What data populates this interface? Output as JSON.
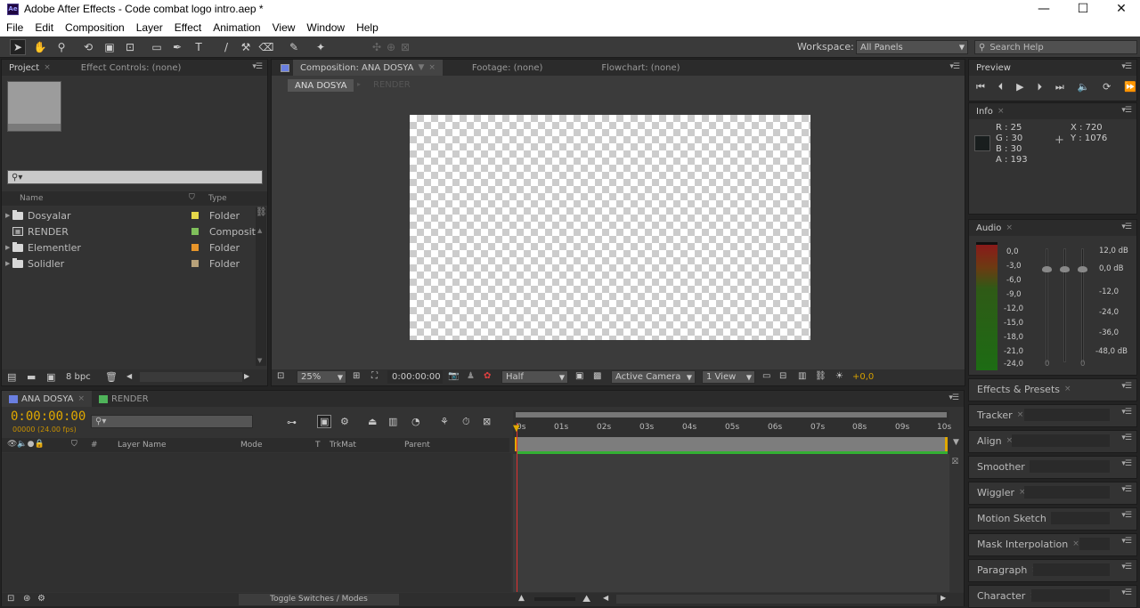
{
  "window": {
    "title": "Adobe After Effects - Code combat logo intro.aep *",
    "app_icon_text": "Ae",
    "minimize_glyph": "—",
    "maximize_glyph": "☐",
    "close_glyph": "✕"
  },
  "menu": [
    "File",
    "Edit",
    "Composition",
    "Layer",
    "Effect",
    "Animation",
    "View",
    "Window",
    "Help"
  ],
  "toolbar": {
    "workspace_label": "Workspace:",
    "workspace_value": "All Panels",
    "search_placeholder": "Search Help"
  },
  "project_panel": {
    "tabs": [
      {
        "label": "Project",
        "active": true
      },
      {
        "label": "Effect Controls: (none)",
        "active": false
      }
    ],
    "search_placeholder": "",
    "columns": {
      "name": "Name",
      "type": "Type"
    },
    "items": [
      {
        "name": "Dosyalar",
        "kind": "folder",
        "label_color": "#e6d84a",
        "type": "Folder"
      },
      {
        "name": "RENDER",
        "kind": "composition",
        "label_color": "#7fc05b",
        "type": "Compositi"
      },
      {
        "name": "Elementler",
        "kind": "folder",
        "label_color": "#e8952a",
        "type": "Folder"
      },
      {
        "name": "Solidler",
        "kind": "folder",
        "label_color": "#b8a27a",
        "type": "Folder"
      }
    ],
    "bpc": "8 bpc"
  },
  "composition_panel": {
    "tabs": [
      {
        "label": "Composition: ANA DOSYA",
        "active": true
      },
      {
        "label": "Footage: (none)",
        "active": false
      },
      {
        "label": "Flowchart: (none)",
        "active": false
      }
    ],
    "breadcrumb": [
      "ANA DOSYA",
      "RENDER"
    ],
    "zoom": "25%",
    "timecode": "0:00:00:00",
    "resolution": "Half",
    "camera": "Active Camera",
    "views": "1 View",
    "exposure": "+0,0"
  },
  "preview_panel": {
    "title": "Preview",
    "controls": [
      "first-frame",
      "previous-frame",
      "play",
      "next-frame",
      "last-frame",
      "audio",
      "loop",
      "ram-preview"
    ]
  },
  "info_panel": {
    "title": "Info",
    "r": "R : 25",
    "g": "G : 30",
    "b": "B : 30",
    "a": "A :  193",
    "x": "X : 720",
    "y": "Y : 1076",
    "swatch_color": "#191e1e"
  },
  "audio_panel": {
    "title": "Audio",
    "left_scale": [
      "0,0",
      "-3,0",
      "-6,0",
      "-9,0",
      "-12,0",
      "-15,0",
      "-18,0",
      "-21,0",
      "-24,0"
    ],
    "right_scale": [
      "12,0 dB",
      "0,0 dB",
      "-12,0",
      "-24,0",
      "-36,0",
      "-48,0 dB"
    ],
    "fader_zero_left": "0",
    "fader_zero_right": "0"
  },
  "side_panels": [
    "Effects & Presets",
    "Tracker",
    "Align",
    "Smoother",
    "Wiggler",
    "Motion Sketch",
    "Mask Interpolation",
    "Paragraph",
    "Character"
  ],
  "timeline": {
    "tabs": [
      {
        "label": "ANA DOSYA",
        "active": true,
        "color": "#6a7fe0"
      },
      {
        "label": "RENDER",
        "active": false,
        "color": "#4fb35a"
      }
    ],
    "timecode": "0:00:00:00",
    "fps": "00000 (24.00 fps)",
    "columns": {
      "layer_name": "Layer Name",
      "mode": "Mode",
      "t": "T",
      "trkmat": "TrkMat",
      "parent": "Parent",
      "number": "#"
    },
    "ruler": [
      "0s",
      "01s",
      "02s",
      "03s",
      "04s",
      "05s",
      "06s",
      "07s",
      "08s",
      "09s",
      "10s"
    ],
    "toggle_label": "Toggle Switches / Modes"
  }
}
